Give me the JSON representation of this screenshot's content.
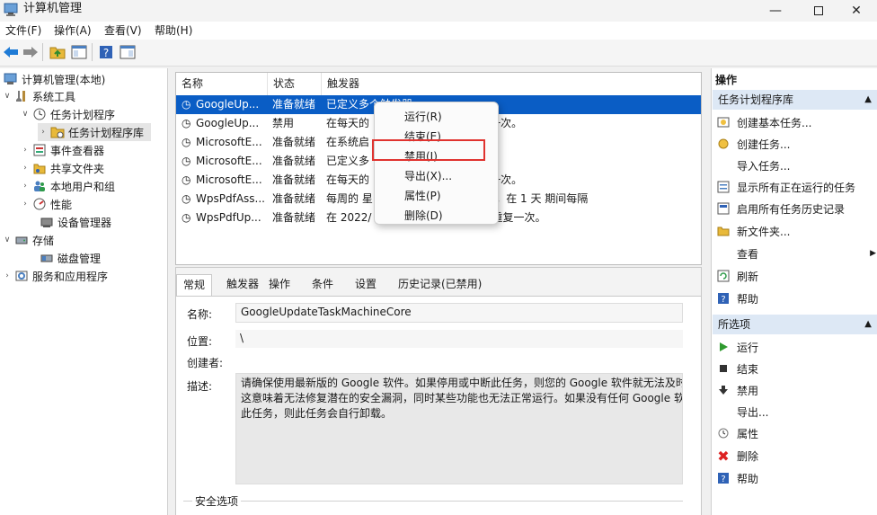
{
  "window": {
    "title": "计算机管理"
  },
  "menubar": {
    "file": "文件(F)",
    "action": "操作(A)",
    "view": "查看(V)",
    "help": "帮助(H)"
  },
  "tree": {
    "root": "计算机管理(本地)",
    "system_tools": "系统工具",
    "task_scheduler": "任务计划程序",
    "task_library": "任务计划程序库",
    "event_viewer": "事件查看器",
    "shared_folders": "共享文件夹",
    "local_users": "本地用户和组",
    "performance": "性能",
    "device_manager": "设备管理器",
    "storage": "存储",
    "disk_management": "磁盘管理",
    "services_apps": "服务和应用程序"
  },
  "list": {
    "headers": {
      "name": "名称",
      "status": "状态",
      "trigger": "触发器"
    },
    "rows": [
      {
        "name": "GoogleUp...",
        "status": "准备就绪",
        "trigger": "已定义多个触发器"
      },
      {
        "name": "GoogleUp...",
        "status": "禁用",
        "trigger": "在每天的 ... 期间每隔 1 小时 重复一次。"
      },
      {
        "name": "MicrosoftE...",
        "status": "准备就绪",
        "trigger": "在系统启"
      },
      {
        "name": "MicrosoftE...",
        "status": "准备就绪",
        "trigger": "已定义多"
      },
      {
        "name": "MicrosoftE...",
        "status": "准备就绪",
        "trigger": "在每天的 ... 期间每隔 1 小时 重复一次。"
      },
      {
        "name": "WpsPdfAss...",
        "status": "准备就绪",
        "trigger": "每周的 星 ... : 2022/3/21 - 触发后，在 1 天 期间每隔"
      },
      {
        "name": "WpsPdfUp...",
        "status": "准备就绪",
        "trigger": "在 2022/ ... 无限期地每隔 1 小时 重复一次。"
      }
    ]
  },
  "context_menu": {
    "run": "运行(R)",
    "end": "结束(E)",
    "disable": "禁用(I)",
    "export": "导出(X)...",
    "properties": "属性(P)",
    "delete": "删除(D)"
  },
  "details": {
    "tabs": [
      "常规",
      "触发器",
      "操作",
      "条件",
      "设置",
      "历史记录(已禁用)"
    ],
    "name_label": "名称:",
    "name_value": "GoogleUpdateTaskMachineCore",
    "location_label": "位置:",
    "location_value": "\\",
    "author_label": "创建者:",
    "desc_label": "描述:",
    "desc_line1": "请确保使用最新版的 Google 软件。如果停用或中断此任务，则您的 Google 软件就无法及时",
    "desc_line2": "这意味着无法修复潜在的安全漏洞，同时某些功能也无法正常运行。如果没有任何 Google 软",
    "desc_line3": "此任务，则此任务会自行卸载。",
    "security_label": "安全选项"
  },
  "actions": {
    "header": "操作",
    "section1": "任务计划程序库",
    "items1": [
      "创建基本任务...",
      "创建任务...",
      "导入任务...",
      "显示所有正在运行的任务",
      "启用所有任务历史记录",
      "新文件夹...",
      "查看",
      "刷新",
      "帮助"
    ],
    "section2": "所选项",
    "items2": [
      "运行",
      "结束",
      "禁用",
      "导出...",
      "属性",
      "删除",
      "帮助"
    ]
  }
}
